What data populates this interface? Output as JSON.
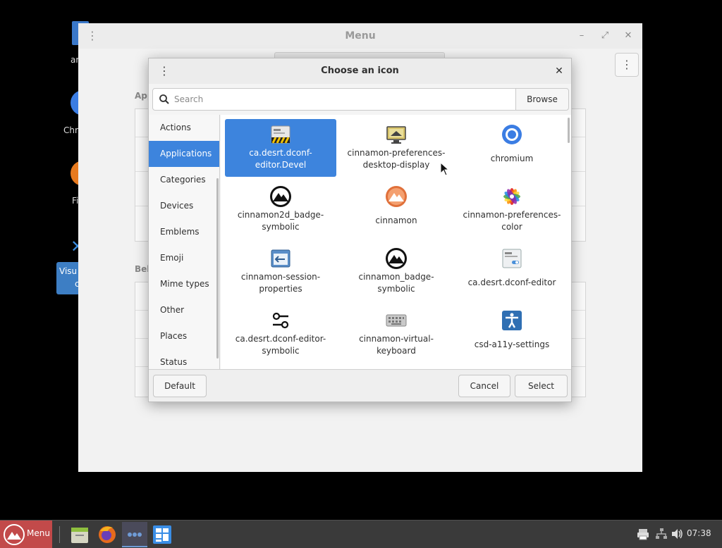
{
  "desktop": {
    "icons": [
      {
        "label": "ar",
        "icon": "file-icon",
        "color": "#3a78c9"
      },
      {
        "label": "Chr",
        "icon": "chromium-icon",
        "color": "#3b7de3"
      },
      {
        "label": "Fi",
        "icon": "firefox-icon",
        "color": "#e77a1f"
      }
    ],
    "selected_icon": {
      "label_line1": "Visu",
      "label_line2": "c"
    }
  },
  "background_window": {
    "title": "Menu",
    "section1": "App",
    "section2": "Beh"
  },
  "dialog": {
    "title": "Choose an icon",
    "search_placeholder": "Search",
    "browse_label": "Browse",
    "categories": [
      "Actions",
      "Applications",
      "Categories",
      "Devices",
      "Emblems",
      "Emoji",
      "Mime types",
      "Other",
      "Places",
      "Status"
    ],
    "active_category": "Applications",
    "icons": [
      {
        "line1": "ca.desrt.dconf-",
        "line2": "editor.Devel",
        "icon": "dconf-devel-icon",
        "selected": true
      },
      {
        "line1": "cinnamon-preferences-",
        "line2": "desktop-display",
        "icon": "display-icon",
        "selected": false
      },
      {
        "line1": "chromium",
        "line2": "",
        "icon": "chromium-icon",
        "selected": false
      },
      {
        "line1": "cinnamon2d_badge-",
        "line2": "symbolic",
        "icon": "cinnamon-badge-icon",
        "selected": false
      },
      {
        "line1": "cinnamon",
        "line2": "",
        "icon": "cinnamon-icon",
        "selected": false
      },
      {
        "line1": "cinnamon-preferences-",
        "line2": "color",
        "icon": "color-icon",
        "selected": false
      },
      {
        "line1": "cinnamon-session-",
        "line2": "properties",
        "icon": "session-icon",
        "selected": false
      },
      {
        "line1": "cinnamon_badge-",
        "line2": "symbolic",
        "icon": "cinnamon-badge-icon",
        "selected": false
      },
      {
        "line1": "ca.desrt.dconf-editor",
        "line2": "",
        "icon": "dconf-editor-icon",
        "selected": false
      },
      {
        "line1": "ca.desrt.dconf-editor-",
        "line2": "symbolic",
        "icon": "dconf-symbolic-icon",
        "selected": false
      },
      {
        "line1": "cinnamon-virtual-",
        "line2": "keyboard",
        "icon": "keyboard-icon",
        "selected": false
      },
      {
        "line1": "csd-a11y-settings",
        "line2": "",
        "icon": "accessibility-icon",
        "selected": false
      }
    ],
    "default_label": "Default",
    "cancel_label": "Cancel",
    "select_label": "Select"
  },
  "taskbar": {
    "menu_label": "Menu",
    "clock": "07:38",
    "accent": "#c24a4a"
  },
  "colors": {
    "selection": "#3d84dd",
    "cinnamon_orange": "#e0703a"
  }
}
